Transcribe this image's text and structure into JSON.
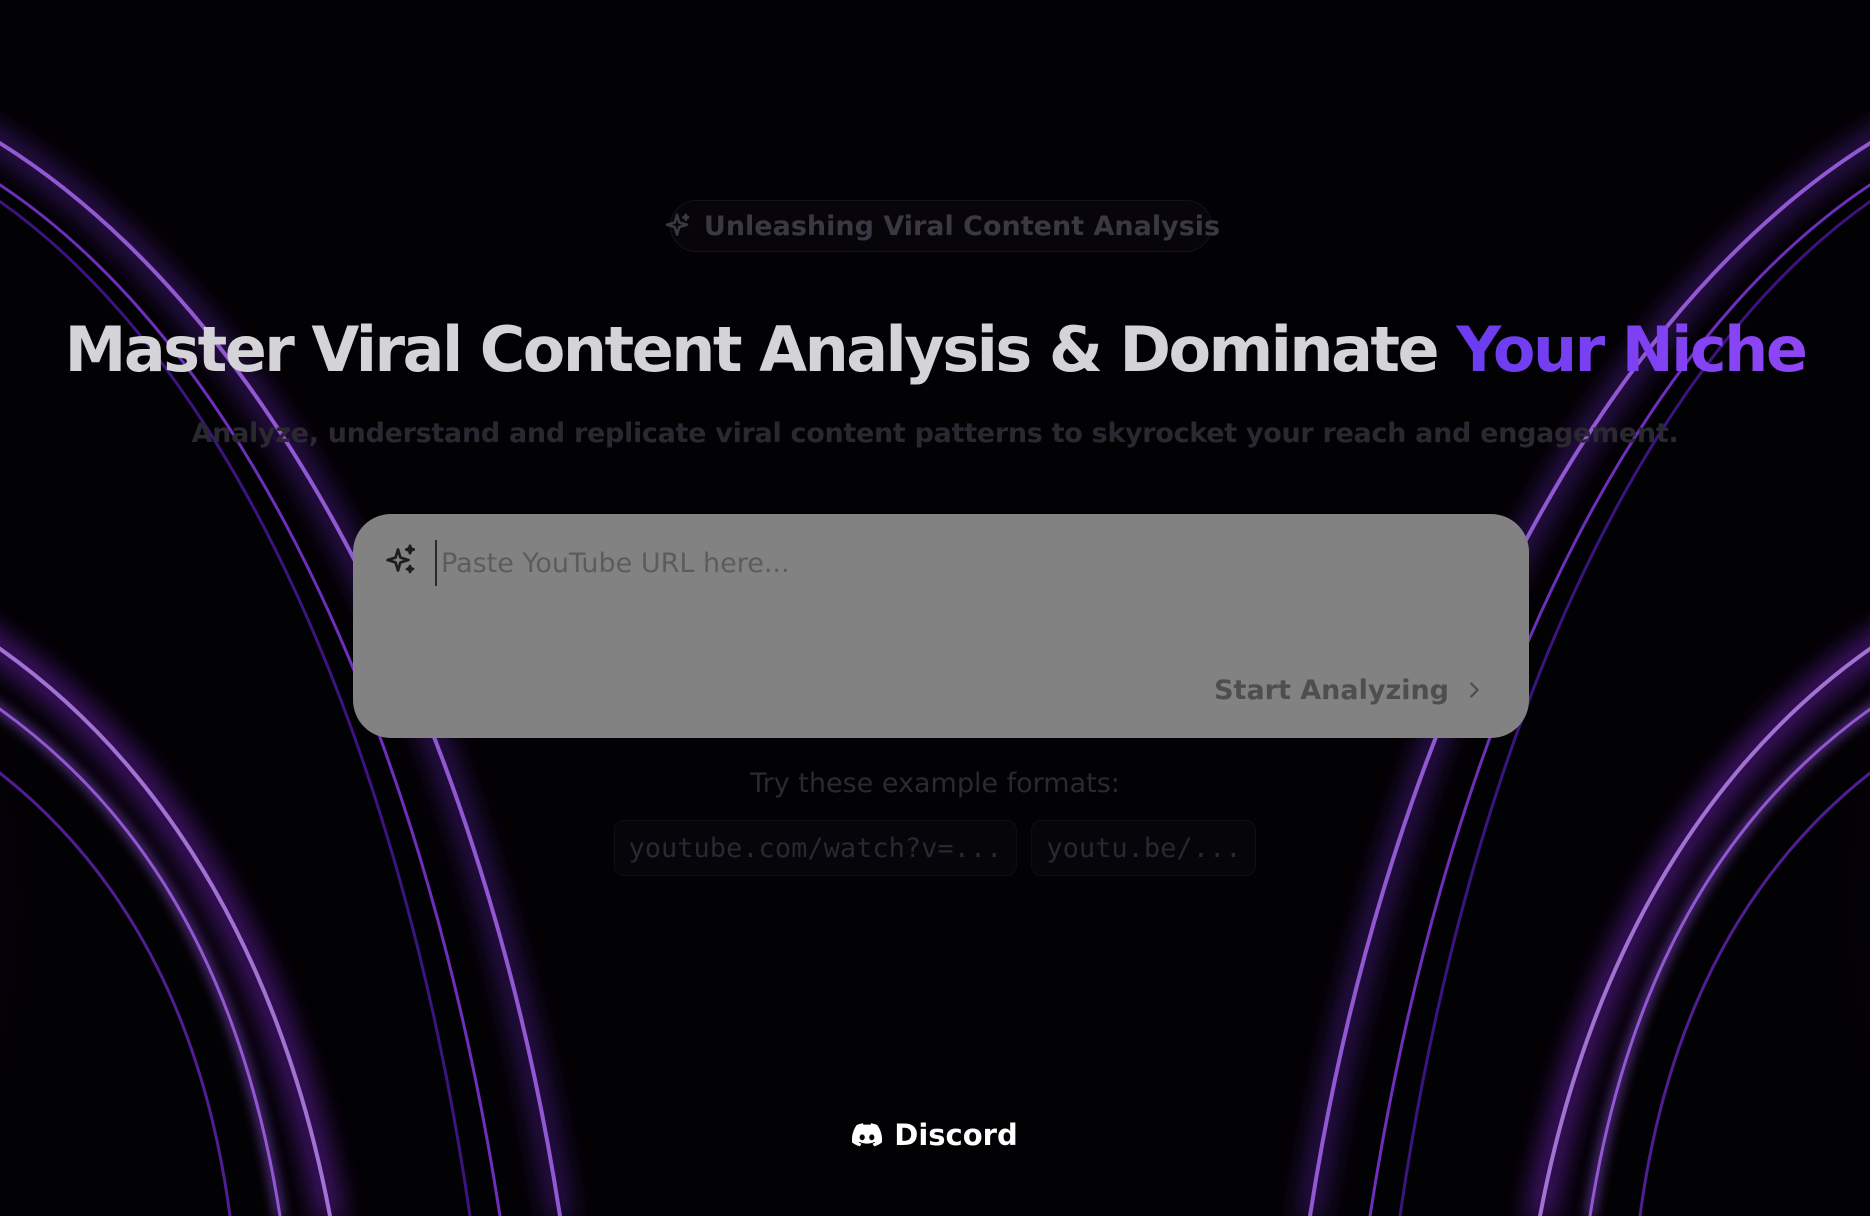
{
  "badge": {
    "text": "Unleashing Viral Content Analysis",
    "icon": "sparkle-icon"
  },
  "hero": {
    "title_main": "Master Viral Content Analysis & Dominate ",
    "title_accent": "Your Niche",
    "subtitle": "Analyze, understand and replicate viral content patterns to skyrocket your reach and engagement."
  },
  "search": {
    "placeholder": "Paste YouTube URL here...",
    "value": "",
    "icon": "sparkles-icon",
    "button_label": "Start Analyzing",
    "button_icon": "chevron-right-icon"
  },
  "examples": {
    "label": "Try these example formats:",
    "items": [
      "youtube.com/watch?v=...",
      "youtu.be/..."
    ]
  },
  "footer": {
    "discord_label": "Discord",
    "discord_icon": "discord-icon"
  },
  "colors": {
    "background": "#030204",
    "accent": "#7b44f2",
    "arc_purple": "#8a2be2",
    "input_bg": "#828282"
  }
}
